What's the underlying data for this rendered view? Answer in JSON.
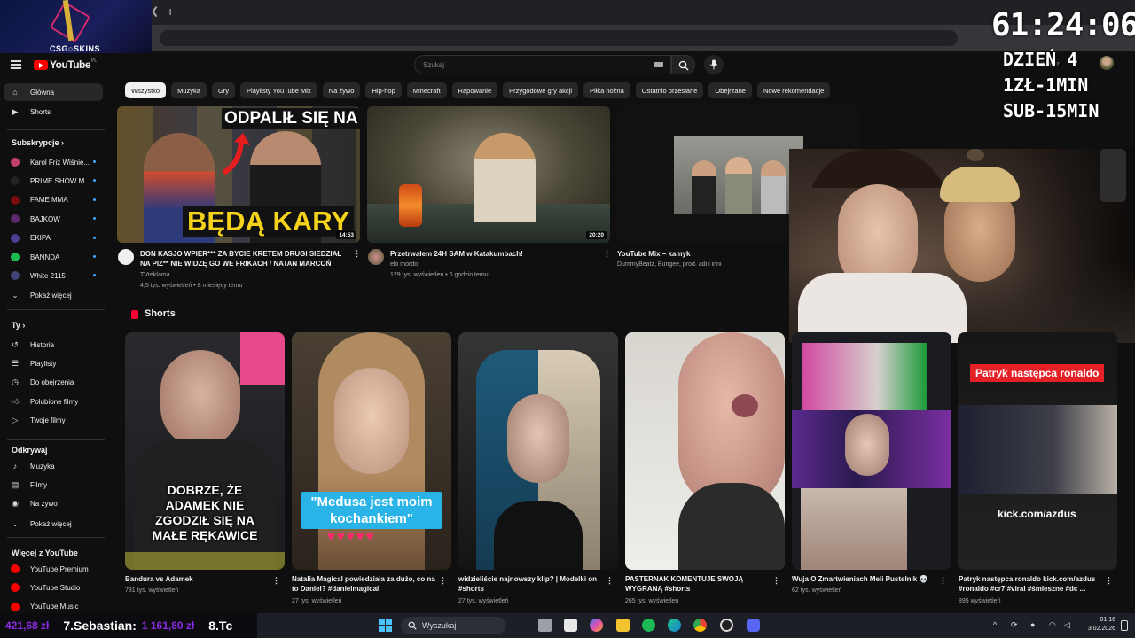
{
  "overlay": {
    "logo_text": "CSG○SKINS",
    "timer": "61:24:06",
    "lines": [
      "DZIEŃ 4",
      "1ZŁ-1MIN",
      "SUB-15MIN"
    ]
  },
  "browser": {
    "new_tab": "+"
  },
  "header": {
    "logo": "YouTube",
    "logo_country": "PL",
    "search_placeholder": "Szukaj"
  },
  "sidebar": {
    "main": [
      {
        "label": "Główna",
        "icon": "home-icon",
        "active": true
      },
      {
        "label": "Shorts",
        "icon": "shorts-icon",
        "active": false
      }
    ],
    "subs_heading": "Subskrypcje",
    "subs": [
      {
        "label": "Karol Friz Wiśnie...",
        "color": "#c2416b"
      },
      {
        "label": "PRIME SHOW MMA",
        "color": "#222222"
      },
      {
        "label": "FAME MMA",
        "color": "#7a0b0b"
      },
      {
        "label": "BAJKOW",
        "color": "#5b2a6e"
      },
      {
        "label": "EKIPA",
        "color": "#4b3c8f"
      },
      {
        "label": "BANNDA",
        "color": "#1db954"
      },
      {
        "label": "White 2115",
        "color": "#444477"
      }
    ],
    "subs_more": "Pokaż więcej",
    "you_heading": "Ty",
    "you": [
      {
        "label": "Historia",
        "icon": "history-icon"
      },
      {
        "label": "Playlisty",
        "icon": "playlist-icon"
      },
      {
        "label": "Do obejrzenia",
        "icon": "watch-later-icon"
      },
      {
        "label": "Polubione filmy",
        "icon": "like-icon"
      },
      {
        "label": "Twoje filmy",
        "icon": "your-videos-icon"
      }
    ],
    "explore_heading": "Odkrywaj",
    "explore": [
      {
        "label": "Muzyka",
        "icon": "music-icon"
      },
      {
        "label": "Filmy",
        "icon": "movies-icon"
      },
      {
        "label": "Na żywo",
        "icon": "live-icon"
      }
    ],
    "explore_more": "Pokaż więcej",
    "more_heading": "Więcej z YouTube",
    "more": [
      {
        "label": "YouTube Premium"
      },
      {
        "label": "YouTube Studio"
      },
      {
        "label": "YouTube Music"
      }
    ]
  },
  "chips": [
    "Wszystko",
    "Muzyka",
    "Gry",
    "Playlisty YouTube Mix",
    "Na żywo",
    "Hip-hop",
    "Minecraft",
    "Rapowanie",
    "Przygodowe gry akcji",
    "Piłka nożna",
    "Ostatnio przesłane",
    "Obejrzane",
    "Nowe rekomendacje"
  ],
  "videos": [
    {
      "title": "DON KASJO WPIER*** ZA BYCIE KRETEM DRUGI SIEDZIAŁ NA PIZ** NIE WIDZĘ GO WE FRIKACH / NATAN MARCOŃ",
      "channel": "TVreklama",
      "meta": "4,5 tys. wyświetleń • 8 miesięcy temu",
      "duration": "14:53",
      "thumb_top": "ODPALIŁ SIĘ NA ..",
      "thumb_bottom": "BĘDĄ KARY"
    },
    {
      "title": "Przetrwałem 24H SAM w Katakumbach!",
      "channel": "elo mordo",
      "meta": "129 tys. wyświetleń • 6 godzin temu",
      "duration": "20:20"
    },
    {
      "title": "YouTube Mix – kamyk",
      "channel": "DummyBeatz, Bungee, prod. adi i inni"
    }
  ],
  "shorts_heading": "Shorts",
  "shorts": [
    {
      "title": "Bandura vs Adamek",
      "views": "781 tys. wyświetleń",
      "caption": "DOBRZE, ŻE ADAMEK NIE ZGODZIŁ SIĘ NA MAŁE RĘKAWICE"
    },
    {
      "title": "Natalia Magical powiedziała za dużo, co na to Daniel? #danielmagical",
      "views": "27 tys. wyświetleń",
      "caption": "\"Medusa jest moim kochankiem\""
    },
    {
      "title": "widzieliście najnowszy klip? | Modelki on #shorts",
      "views": "27 tys. wyświetleń"
    },
    {
      "title": "PASTERNAK KOMENTUJE SWOJĄ WYGRANĄ #shorts",
      "views": "265 tys. wyświetleń"
    },
    {
      "title": "Wuja O Zmartwieniach Meli Pustelnik 💀",
      "views": "62 tys. wyświetleń"
    },
    {
      "title": "Patryk następca ronaldo kick.com/azdus #ronaldo #cr7 #viral #śmieszne #dc ...",
      "views": "895 wyświetleń",
      "caption_top": "Patryk następca ronaldo",
      "caption_bottom": "kick.com/azdus"
    }
  ],
  "taskbar": {
    "donor_amount": "421,68 zł",
    "donor_name": "7.Sebastian:",
    "donor_amount2": "1 161,80 zł",
    "donor_next": "8.Tc",
    "search": "Wyszukaj",
    "time": "01:16",
    "date": "3.02.2026"
  },
  "colors": {
    "accent": "#ff0000",
    "background": "#0f0f0f",
    "donor_purple": "#8a2be2",
    "donor_name": "#ffffff"
  }
}
